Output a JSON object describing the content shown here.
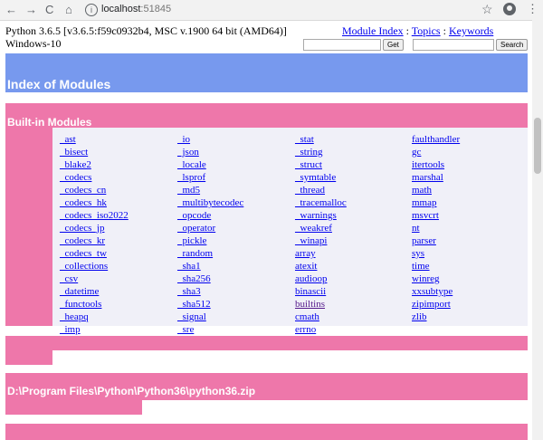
{
  "browser": {
    "url_host": "localhost",
    "url_port": ":51845",
    "back_glyph": "←",
    "forward_glyph": "→",
    "reload_glyph": "C",
    "home_glyph": "⌂",
    "info_glyph": "i",
    "star_glyph": "☆",
    "menu_glyph": "⋮"
  },
  "header": {
    "python_version_line1": "Python 3.6.5 [v3.6.5:f59c0932b4, MSC v.1900 64 bit (AMD64)]",
    "python_version_line2": "Windows-10",
    "links": {
      "module_index": "Module Index",
      "sep1": " : ",
      "topics": "Topics",
      "sep2": " : ",
      "keywords": "Keywords"
    },
    "get_button": "Get",
    "search_button": "Search",
    "get_input_value": "",
    "search_input_value": ""
  },
  "index_title": "Index of Modules",
  "builtin_title": "Built-in Modules",
  "columns": [
    [
      "_ast",
      "_bisect",
      "_blake2",
      "_codecs",
      "_codecs_cn",
      "_codecs_hk",
      "_codecs_iso2022",
      "_codecs_jp",
      "_codecs_kr",
      "_codecs_tw",
      "_collections",
      "_csv",
      "_datetime",
      "_functools",
      "_heapq",
      "_imp"
    ],
    [
      "_io",
      "_json",
      "_locale",
      "_lsprof",
      "_md5",
      "_multibytecodec",
      "_opcode",
      "_operator",
      "_pickle",
      "_random",
      "_sha1",
      "_sha256",
      "_sha3",
      "_sha512",
      "_signal",
      "_sre"
    ],
    [
      "_stat",
      "_string",
      "_struct",
      "_symtable",
      "_thread",
      "_tracemalloc",
      "_warnings",
      "_weakref",
      "_winapi",
      "array",
      "atexit",
      "audioop",
      "binascii",
      "builtins",
      "cmath",
      "errno"
    ],
    [
      "faulthandler",
      "gc",
      "itertools",
      "marshal",
      "math",
      "mmap",
      "msvcrt",
      "nt",
      "parser",
      "sys",
      "time",
      "winreg",
      "xxsubtype",
      "zipimport",
      "zlib"
    ]
  ],
  "zip_section_title": "D:\\Program Files\\Python\\Python36\\python36.zip",
  "colors": {
    "index_header": "#7799ee",
    "section_header": "#ee77aa",
    "section_body": "#f0f0f8",
    "link": "#0000ee",
    "visited_link": "#551a8b"
  }
}
